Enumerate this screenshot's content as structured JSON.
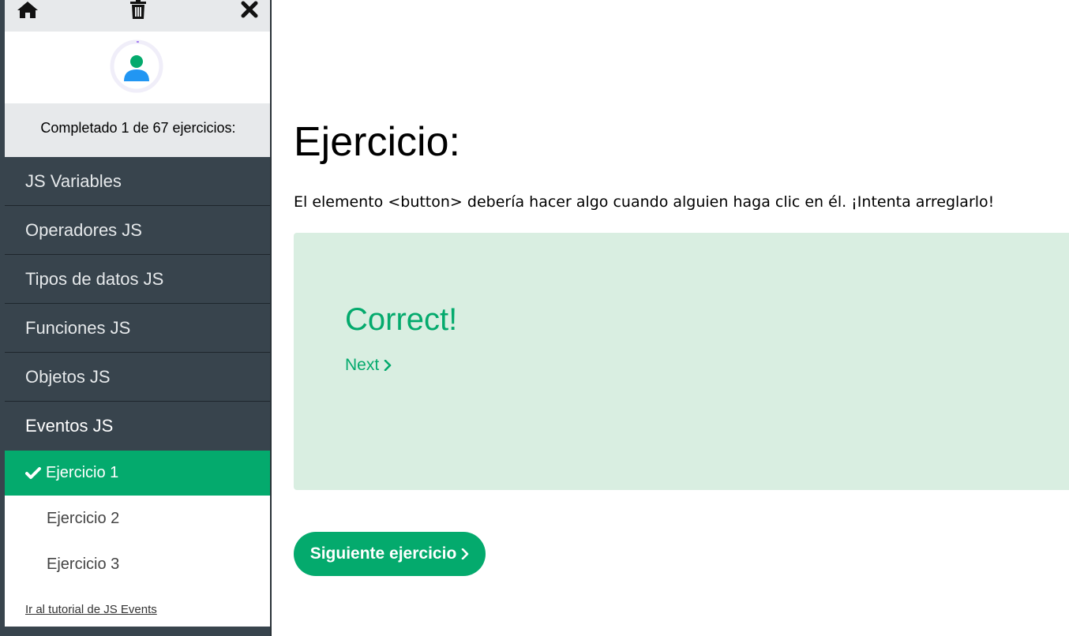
{
  "sidebar": {
    "progress_text": "Completado 1 de 67 ejercicios:",
    "menu": [
      {
        "label": "JS Variables"
      },
      {
        "label": "Operadores JS"
      },
      {
        "label": "Tipos de datos JS"
      },
      {
        "label": "Funciones JS"
      },
      {
        "label": "Objetos JS"
      },
      {
        "label": "Eventos JS"
      }
    ],
    "exercises": [
      {
        "label": "Ejercicio 1",
        "completed": true
      },
      {
        "label": "Ejercicio 2",
        "completed": false
      },
      {
        "label": "Ejercicio 3",
        "completed": false
      }
    ],
    "tutorial_link": "Ir al tutorial de JS Events",
    "progress_fraction": 0.015
  },
  "main": {
    "title": "Ejercicio:",
    "description": "El elemento <button> debería hacer algo cuando alguien haga clic en él. ¡Intenta arreglarlo!",
    "result_title": "Correct!",
    "next_link": "Next",
    "next_button": "Siguiente ejercicio"
  },
  "colors": {
    "accent": "#04aa6d",
    "sidebar_bg": "#38444d",
    "result_bg": "#d9eee1",
    "topbar_bg": "#e7e9eb"
  },
  "icons": [
    "home-icon",
    "trash-icon",
    "close-icon",
    "user-icon",
    "check-icon",
    "chevron-right-icon"
  ]
}
